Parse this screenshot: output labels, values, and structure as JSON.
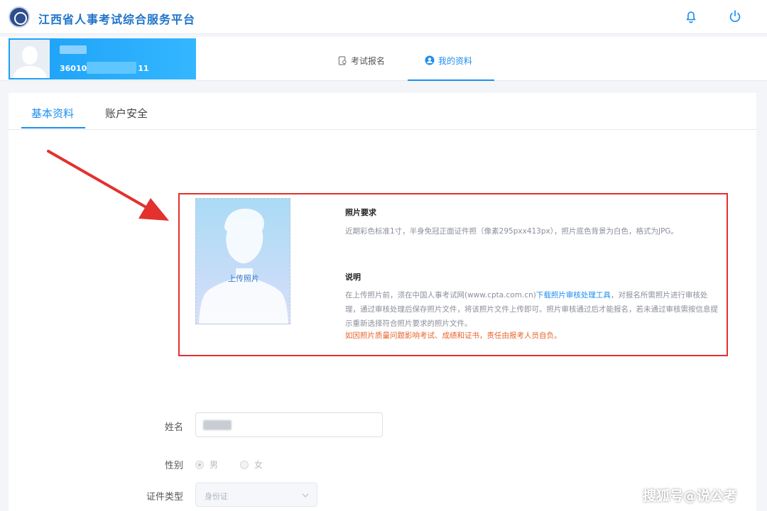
{
  "header": {
    "title": "江西省人事考试综合服务平台",
    "icons": [
      "logo-icon",
      "bell-icon",
      "power-icon"
    ]
  },
  "profile": {
    "id_prefix": "36010",
    "id_suffix": "11"
  },
  "nav": {
    "tabs": [
      {
        "label": "考试报名",
        "icon": "exam-doc-icon",
        "active": false
      },
      {
        "label": "我的资料",
        "icon": "user-circle-icon",
        "active": true
      }
    ]
  },
  "sub_tabs": [
    {
      "label": "基本资料",
      "active": true
    },
    {
      "label": "账户安全",
      "active": false
    }
  ],
  "photo": {
    "upload_label": "上传照片",
    "req_title": "照片要求",
    "req_text": "近期彩色标准1寸，半身免冠正面证件照（像素295pxx413px），照片底色背景为白色，格式为JPG。",
    "note_title": "说明",
    "note_text_1": "在上传照片前，须在中国人事考试网(www.cpta.com.cn)",
    "note_link": "下载照片审核处理工具",
    "note_text_2": "，对报名所需照片进行审核处理，通过审核处理后保存照片文件，将该照片文件上传即可。照片审核通过后才能报名，若未通过审核需按信息提示重新选择符合照片要求的照片文件。",
    "note_warning": "如因照片质量问题影响考试、成绩和证书，责任由报考人员自负。"
  },
  "form": {
    "name_label": "姓名",
    "gender_label": "性别",
    "gender_options": [
      "男",
      "女"
    ],
    "gender_selected": "男",
    "id_type_label": "证件类型",
    "id_type_value": "身份证"
  },
  "watermark": "搜狐号@说公考",
  "colors": {
    "accent": "#1e8ff0",
    "title_blue": "#1e73c9",
    "highlight_red": "#e3312e",
    "warning_orange": "#e8642b"
  }
}
